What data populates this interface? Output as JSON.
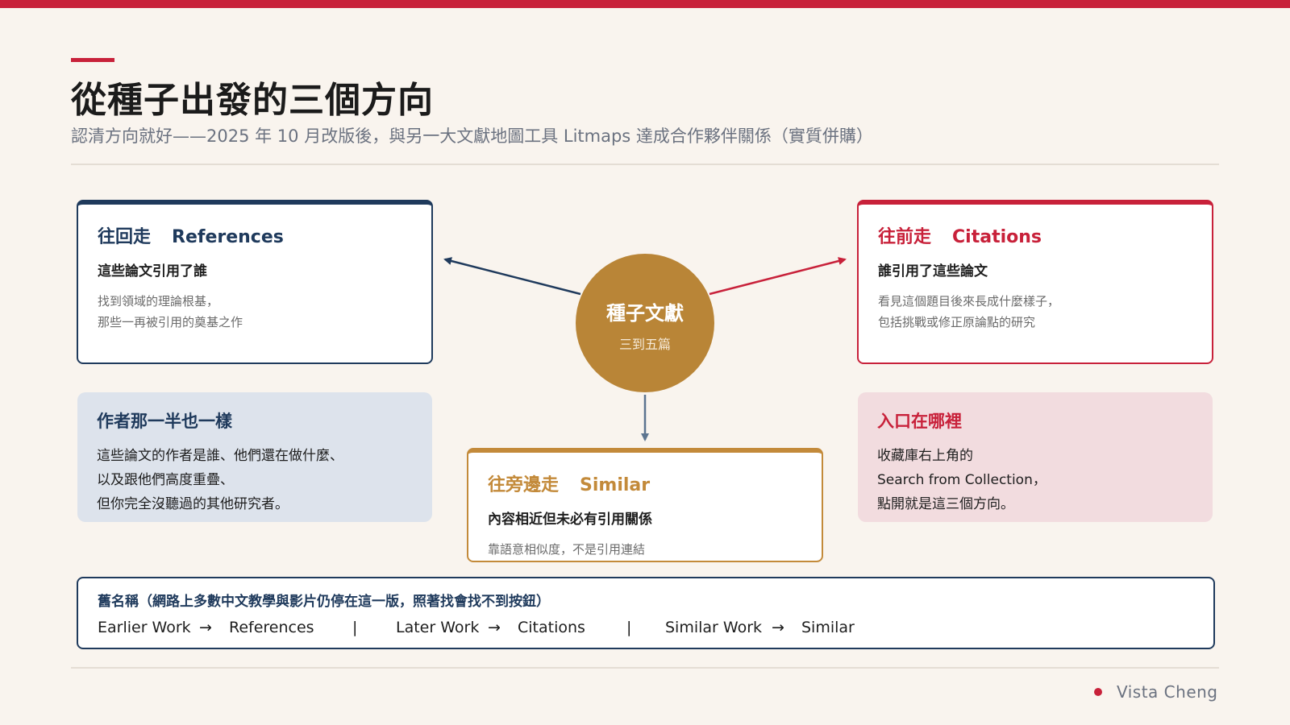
{
  "page": {
    "title": "從種子出發的三個方向",
    "subtitle": "認清方向就好——2025 年 10 月改版後，與另一大文獻地圖工具 Litmaps 達成合作夥伴關係（實質併購）"
  },
  "seed": {
    "title": "種子文獻",
    "subtitle": "三到五篇"
  },
  "references": {
    "head_zh": "往回走",
    "head_en": "References",
    "sub": "這些論文引用了誰",
    "desc": [
      "找到領域的理論根基，",
      "那些一再被引用的奠基之作"
    ]
  },
  "citations": {
    "head_zh": "往前走",
    "head_en": "Citations",
    "sub": "誰引用了這些論文",
    "desc": [
      "看見這個題目後來長成什麼樣子，",
      "包括挑戰或修正原論點的研究"
    ]
  },
  "similar": {
    "head_zh": "往旁邊走",
    "head_en": "Similar",
    "sub": "內容相近但未必有引用關係",
    "desc": "靠語意相似度，不是引用連結"
  },
  "authors_note": {
    "head": "作者那一半也一樣",
    "lines": [
      "這些論文的作者是誰、他們還在做什麼、",
      "以及跟他們高度重疊、",
      "但你完全沒聽過的其他研究者。"
    ]
  },
  "entry_note": {
    "head": "入口在哪裡",
    "lines": [
      "收藏庫右上角的",
      "Search from Collection，",
      "點開就是這三個方向。"
    ]
  },
  "legacy": {
    "title": "舊名稱（網路上多數中文教學與影片仍停在這一版，照著找會找不到按鈕）",
    "arrow": "→",
    "separator": "|",
    "mappings": [
      {
        "old": "Earlier Work",
        "new": "References"
      },
      {
        "old": "Later Work",
        "new": "Citations"
      },
      {
        "old": "Similar Work",
        "new": "Similar"
      }
    ]
  },
  "footer": {
    "author": "Vista Cheng"
  },
  "colors": {
    "red": "#c8213a",
    "navy": "#1f3a5c",
    "gold": "#b98537",
    "background": "#f9f4ee"
  }
}
